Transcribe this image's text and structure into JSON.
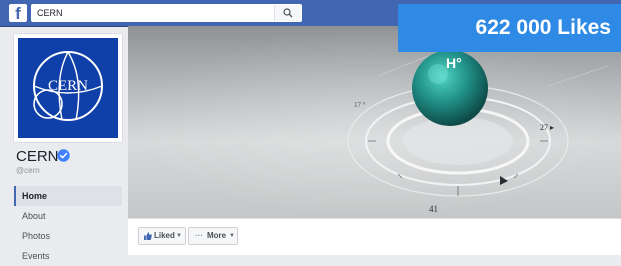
{
  "topbar": {
    "logo_letter": "f",
    "search": {
      "value": "CERN",
      "placeholder": "Search"
    }
  },
  "likes_banner": "622 000 Likes",
  "profile": {
    "logo_text": "CERN",
    "name": "CERN",
    "handle": "@cern"
  },
  "nav": {
    "items": [
      {
        "label": "Home",
        "active": true
      },
      {
        "label": "About"
      },
      {
        "label": "Photos"
      },
      {
        "label": "Events"
      }
    ]
  },
  "cover": {
    "sphere_label": "H°",
    "dial_labels": [
      "17 °",
      "41",
      "27 ▸"
    ]
  },
  "actions": {
    "liked_label": "Liked",
    "more_label": "More",
    "more_prefix": "···"
  },
  "colors": {
    "topbar": "#4267b2",
    "likes_banner": "#2f8ae5",
    "cern_blue": "#0f3fa8",
    "verified": "#4080ff"
  }
}
